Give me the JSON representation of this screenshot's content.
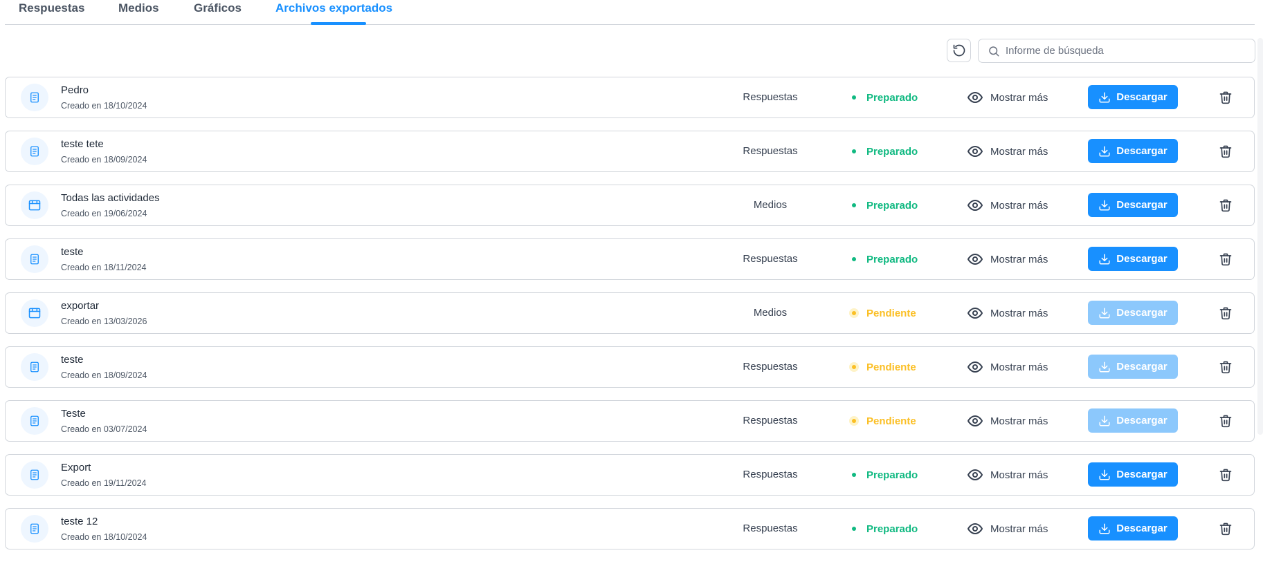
{
  "tabs": [
    {
      "label": "Respuestas",
      "active": false
    },
    {
      "label": "Medios",
      "active": false
    },
    {
      "label": "Gráficos",
      "active": false
    },
    {
      "label": "Archivos exportados",
      "active": true
    }
  ],
  "toolbar": {
    "refresh_icon": "refresh-icon",
    "search_placeholder": "Informe de búsqueda",
    "search_value": ""
  },
  "colors": {
    "accent": "#1890ff",
    "ready": "#10b981",
    "pending": "#fbbf24",
    "download_disabled": "#8cc8fc"
  },
  "rows": [
    {
      "name": "Pedro",
      "date": "Creado en 18/10/2024",
      "type": "Respuestas",
      "icon": "document-icon",
      "status": "Preparado",
      "status_kind": "ready",
      "show_more": "Mostrar más",
      "download": "Descargar",
      "download_enabled": true
    },
    {
      "name": "teste tete",
      "date": "Creado en 18/09/2024",
      "type": "Respuestas",
      "icon": "document-icon",
      "status": "Preparado",
      "status_kind": "ready",
      "show_more": "Mostrar más",
      "download": "Descargar",
      "download_enabled": true
    },
    {
      "name": "Todas las actividades",
      "date": "Creado en 19/06/2024",
      "type": "Medios",
      "icon": "media-icon",
      "status": "Preparado",
      "status_kind": "ready",
      "show_more": "Mostrar más",
      "download": "Descargar",
      "download_enabled": true
    },
    {
      "name": "teste",
      "date": "Creado en 18/11/2024",
      "type": "Respuestas",
      "icon": "document-icon",
      "status": "Preparado",
      "status_kind": "ready",
      "show_more": "Mostrar más",
      "download": "Descargar",
      "download_enabled": true
    },
    {
      "name": "exportar",
      "date": "Creado en 13/03/2026",
      "type": "Medios",
      "icon": "media-icon",
      "status": "Pendiente",
      "status_kind": "pending",
      "show_more": "Mostrar más",
      "download": "Descargar",
      "download_enabled": false
    },
    {
      "name": "teste",
      "date": "Creado en 18/09/2024",
      "type": "Respuestas",
      "icon": "document-icon",
      "status": "Pendiente",
      "status_kind": "pending",
      "show_more": "Mostrar más",
      "download": "Descargar",
      "download_enabled": false
    },
    {
      "name": "Teste",
      "date": "Creado en 03/07/2024",
      "type": "Respuestas",
      "icon": "document-icon",
      "status": "Pendiente",
      "status_kind": "pending",
      "show_more": "Mostrar más",
      "download": "Descargar",
      "download_enabled": false
    },
    {
      "name": "Export",
      "date": "Creado en 19/11/2024",
      "type": "Respuestas",
      "icon": "document-icon",
      "status": "Preparado",
      "status_kind": "ready",
      "show_more": "Mostrar más",
      "download": "Descargar",
      "download_enabled": true
    },
    {
      "name": "teste 12",
      "date": "Creado en 18/10/2024",
      "type": "Respuestas",
      "icon": "document-icon",
      "status": "Preparado",
      "status_kind": "ready",
      "show_more": "Mostrar más",
      "download": "Descargar",
      "download_enabled": true
    }
  ]
}
